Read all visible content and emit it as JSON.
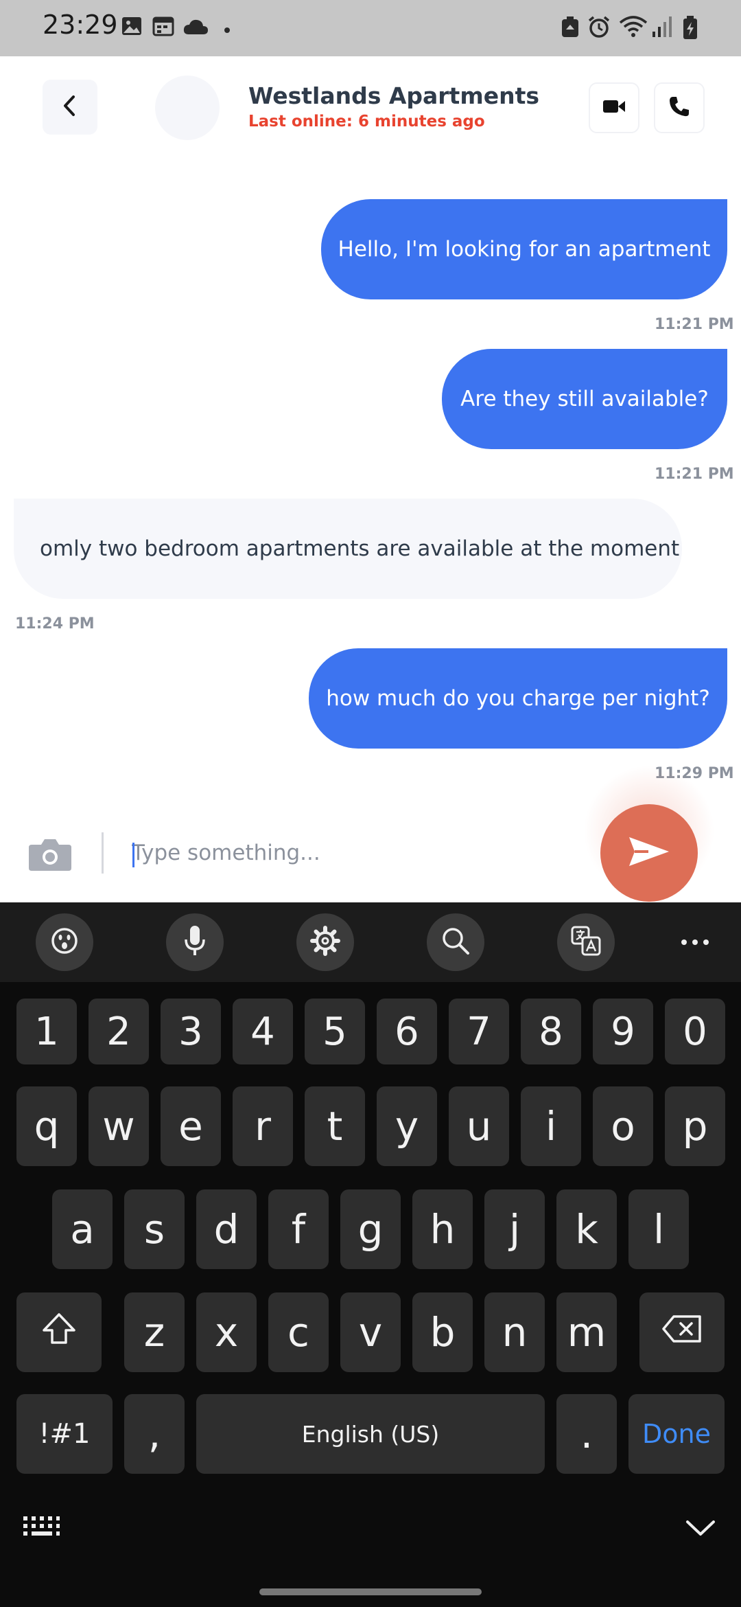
{
  "status_bar": {
    "time": "23:29",
    "left_icons": [
      "gallery-icon",
      "calendar-icon",
      "cloud-icon",
      "dot-icon"
    ],
    "right_icons": [
      "recycle-icon",
      "alarm-icon",
      "wifi-icon",
      "signal-icon",
      "battery-charging-icon"
    ]
  },
  "header": {
    "contact_name": "Westlands Apartments",
    "last_online": "Last online: 6 minutes ago",
    "status_color": "#e8432f"
  },
  "messages": [
    {
      "direction": "outgoing",
      "text": "Hello, I'm looking for an apartment",
      "time": "11:21 PM"
    },
    {
      "direction": "outgoing",
      "text": "Are they still available?",
      "time": "11:21 PM"
    },
    {
      "direction": "incoming",
      "text": "omly two bedroom apartments are available at the moment",
      "time": "11:24 PM"
    },
    {
      "direction": "outgoing",
      "text": "how much do you charge per night?",
      "time": "11:29 PM"
    }
  ],
  "composer": {
    "placeholder": "Type something...",
    "value": ""
  },
  "colors": {
    "outgoing_bubble": "#3d74f0",
    "incoming_bubble": "#f6f7fb",
    "send_button": "#dd6e56"
  },
  "keyboard": {
    "toolbar_icons": [
      "emoji-icon",
      "microphone-icon",
      "settings-icon",
      "search-icon",
      "translate-icon",
      "more-icon"
    ],
    "number_row": [
      "1",
      "2",
      "3",
      "4",
      "5",
      "6",
      "7",
      "8",
      "9",
      "0"
    ],
    "row1": [
      "q",
      "w",
      "e",
      "r",
      "t",
      "y",
      "u",
      "i",
      "o",
      "p"
    ],
    "row2": [
      "a",
      "s",
      "d",
      "f",
      "g",
      "h",
      "j",
      "k",
      "l"
    ],
    "row3": [
      "z",
      "x",
      "c",
      "v",
      "b",
      "n",
      "m"
    ],
    "symbols_label": "!#1",
    "comma_label": ",",
    "space_label": "English (US)",
    "period_label": ".",
    "done_label": "Done",
    "bottom_icons": [
      "keyboard-grid-icon",
      "hide-keyboard-icon"
    ]
  }
}
